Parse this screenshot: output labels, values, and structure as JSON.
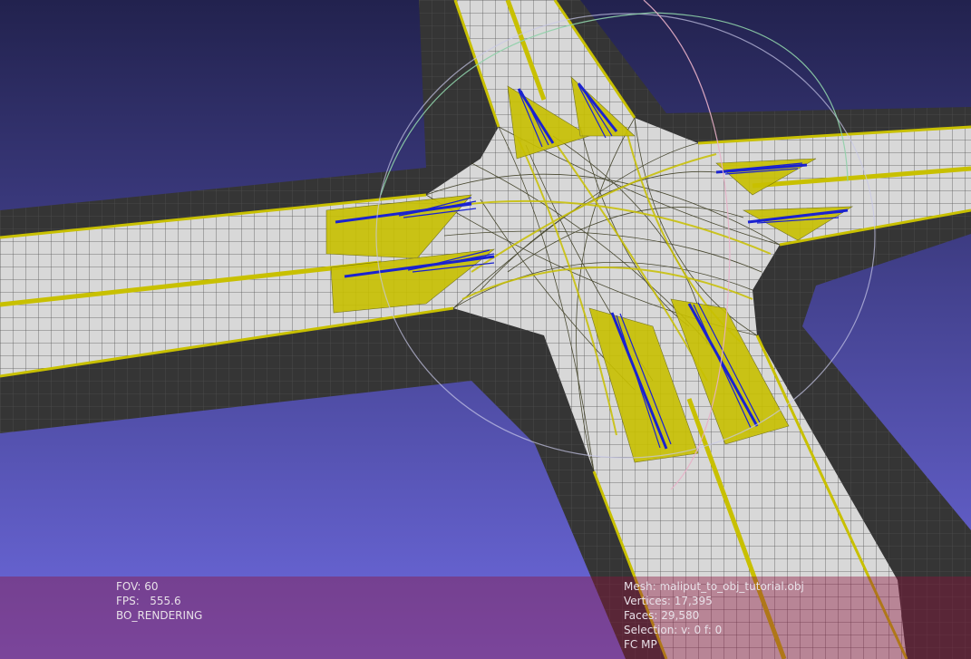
{
  "render_stats": {
    "fov": "FOV: 60",
    "fps": "FPS:   555.6",
    "mode": "BO_RENDERING"
  },
  "mesh_info": {
    "mesh": "Mesh: maliput_to_obj_tutorial.obj",
    "vertices": "Vertices: 17,395",
    "faces": "Faces: 29,580",
    "selection": "Selection: v: 0 f: 0",
    "flags": "FC MP"
  },
  "colors": {
    "background_top": "#28285a",
    "background_bottom": "#6e6ae0",
    "road_surface": "#d8d8d8",
    "road_shoulder": "#353535",
    "lane_marking": "#c8c000",
    "arrow": "#1a22d0",
    "overlay": "#8c143c"
  }
}
